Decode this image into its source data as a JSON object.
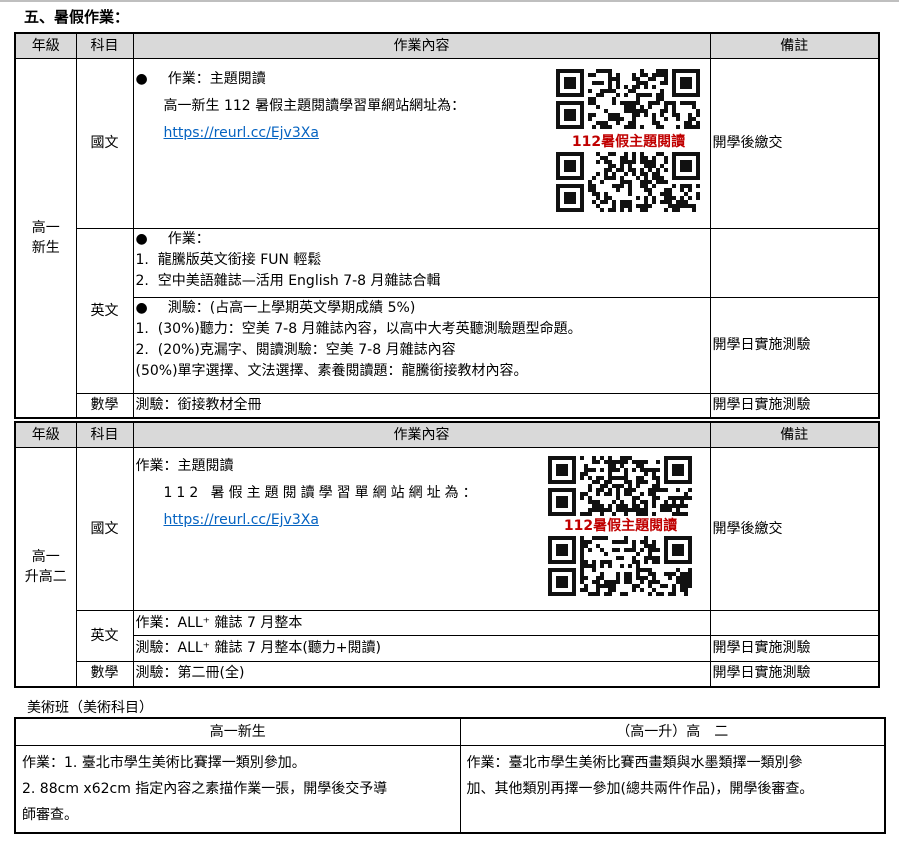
{
  "section_title": "五、暑假作業：",
  "headers": {
    "grade": "年級",
    "subject": "科目",
    "content": "作業內容",
    "notes": "備註"
  },
  "section1": {
    "grade": [
      "高一",
      "新生"
    ],
    "chinese": {
      "subject": "國文",
      "bullet": "●",
      "line1": "作業：主題閱讀",
      "line2": "高一新生 112 暑假主題閱讀學習單網站網址為：",
      "url": "https://reurl.cc/Ejv3Xa",
      "qr_label": "112暑假主題閱讀",
      "note": "開學後繳交"
    },
    "english": {
      "subject": "英文",
      "hw_bullet": "●",
      "hw_title": "作業：",
      "hw_items": [
        "1.  龍騰版英文銜接 FUN 輕鬆",
        "2.  空中美語雜誌—活用 English 7-8 月雜誌合輯"
      ],
      "test_bullet": "●",
      "test_title": "測驗：(占高一上學期英文學期成績 5%)",
      "test_items": [
        "1.  (30%)聽力：空美 7-8 月雜誌內容，以高中大考英聽測驗題型命題。",
        "2.  (20%)克漏字、閱讀測驗：空美 7-8 月雜誌內容",
        "(50%)單字選擇、文法選擇、素養閱讀題：龍騰銜接教材內容。"
      ],
      "note": "開學日實施測驗"
    },
    "math": {
      "subject": "數學",
      "content": "測驗：銜接教材全冊",
      "note": "開學日實施測驗"
    }
  },
  "section2": {
    "grade": [
      "高一",
      "升高二"
    ],
    "chinese": {
      "subject": "國文",
      "line1": "作業：主題閱讀",
      "line2": "112 暑假主題閱讀學習單網站網址為：",
      "url": "https://reurl.cc/Ejv3Xa",
      "qr_label": "112暑假主題閱讀",
      "note": "開學後繳交"
    },
    "english": {
      "subject": "英文",
      "hw": "作業：ALL⁺ 雜誌 7 月整本",
      "test": "測驗：ALL⁺ 雜誌 7 月整本(聽力+閱讀)",
      "test_note": "開學日實施測驗"
    },
    "math": {
      "subject": "數學",
      "content": "測驗：第二冊(全)",
      "note": "開學日實施測驗"
    }
  },
  "art": {
    "title": "美術班（美術科目）",
    "col1_header": "高一新生",
    "col2_header": "（高一升）高　二",
    "col1_lines": [
      "作業：1. 臺北市學生美術比賽擇一類別參加。",
      "2. 88cm x62cm 指定內容之素描作業一張，開學後交予導",
      "師審查。"
    ],
    "col2_lines": [
      "作業：臺北市學生美術比賽西畫類與水墨類擇一類別參",
      "加、其他類別再擇一參加(總共兩件作品)，開學後審查。"
    ]
  }
}
